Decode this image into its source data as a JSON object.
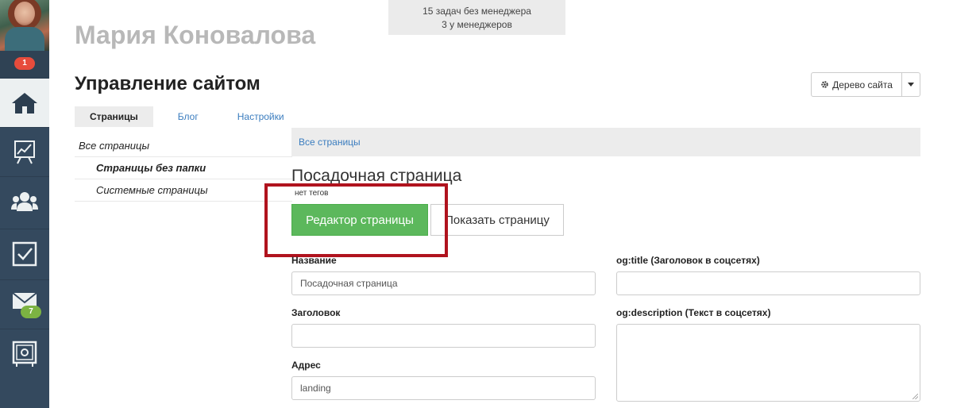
{
  "user": {
    "name": "Мария Коновалова"
  },
  "notifications": {
    "count": "1"
  },
  "tasks": {
    "line1": "15 задач без менеджера",
    "line2": "3 у менеджеров"
  },
  "page": {
    "title": "Управление сайтом"
  },
  "site_tree": {
    "label": "Дерево сайта",
    "icon": "gear-icon"
  },
  "tabs": [
    {
      "label": "Страницы",
      "active": true
    },
    {
      "label": "Блог",
      "active": false
    },
    {
      "label": "Настройки",
      "active": false
    }
  ],
  "folders": [
    {
      "label": "Все страницы"
    },
    {
      "label": "Страницы без папки"
    },
    {
      "label": "Системные страницы"
    }
  ],
  "breadcrumb": {
    "label": "Все страницы"
  },
  "landing": {
    "title": "Посадочная страница",
    "tags_note": "нет тегов",
    "editor_button": "Редактор страницы",
    "show_button": "Показать страницу"
  },
  "form": {
    "name_label": "Название",
    "name_value": "Посадочная страница",
    "heading_label": "Заголовок",
    "heading_value": "",
    "address_label": "Адрес",
    "address_value": "landing",
    "og_title_label": "og:title (Заголовок в соцсетях)",
    "og_title_value": "",
    "og_desc_label": "og:description (Текст в соцсетях)"
  },
  "messages": {
    "count": "7"
  },
  "nav_icons": [
    "home-icon",
    "chart-icon",
    "users-icon",
    "tasks-icon",
    "mail-icon",
    "safe-icon"
  ],
  "colors": {
    "sidebar": "#34495e",
    "accent_green": "#5cb85c",
    "highlight_red": "#b0131e",
    "link": "#3b7dbf"
  }
}
